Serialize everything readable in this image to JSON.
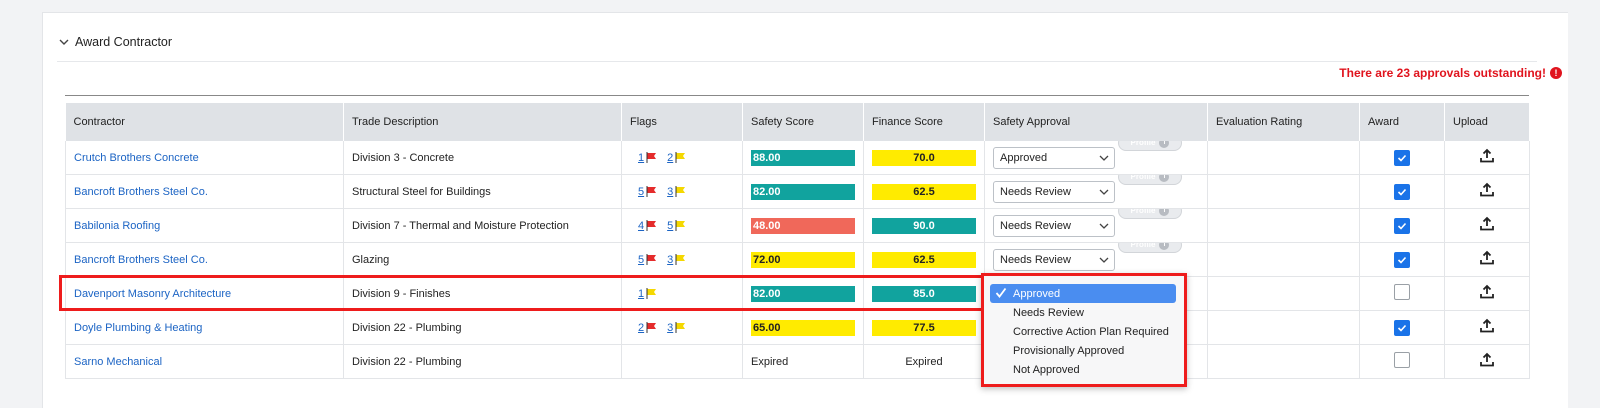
{
  "section": {
    "title": "Award Contractor"
  },
  "alert": {
    "text": "There are 23 approvals outstanding!",
    "icon": "!"
  },
  "columns": [
    "Contractor",
    "Trade Description",
    "Flags",
    "Safety Score",
    "Finance Score",
    "Safety Approval",
    "Evaluation Rating",
    "Award",
    "Upload"
  ],
  "profile_label": "Profile",
  "profile_info": "i",
  "colors": {
    "red_flag": "#e52b2b",
    "yellow_flag": "#f5d800",
    "teal": "#11a39e",
    "yellow": "#ffeb00",
    "red": "#f0685a",
    "link": "#1c64c4",
    "highlight": "#ee1c1c"
  },
  "rows": [
    {
      "contractor": "Crutch Brothers Concrete",
      "trade": "Division 3 - Concrete",
      "red_flags": "1",
      "yellow_flags": "2",
      "safety": "88.00",
      "safety_color": "#11a39e",
      "finance": "70.0",
      "finance_color": "#ffeb00",
      "approval": "Approved",
      "award": true
    },
    {
      "contractor": "Bancroft Brothers Steel Co.",
      "trade": "Structural Steel for Buildings",
      "red_flags": "5",
      "yellow_flags": "3",
      "safety": "82.00",
      "safety_color": "#11a39e",
      "finance": "62.5",
      "finance_color": "#ffeb00",
      "approval": "Needs Review",
      "award": true
    },
    {
      "contractor": "Babilonia Roofing",
      "trade": "Division 7 - Thermal and Moisture Protection",
      "red_flags": "4",
      "yellow_flags": "5",
      "safety": "48.00",
      "safety_color": "#f0685a",
      "finance": "90.0",
      "finance_color": "#11a39e",
      "approval": "Needs Review",
      "award": true
    },
    {
      "contractor": "Bancroft Brothers Steel Co.",
      "trade": "Glazing",
      "red_flags": "5",
      "yellow_flags": "3",
      "safety": "72.00",
      "safety_color": "#ffeb00",
      "finance": "62.5",
      "finance_color": "#ffeb00",
      "approval": "Needs Review",
      "award": true
    },
    {
      "contractor": "Davenport Masonry Architecture",
      "trade": "Division 9 - Finishes",
      "red_flags": "",
      "yellow_flags": "1",
      "safety": "82.00",
      "safety_color": "#11a39e",
      "finance": "85.0",
      "finance_color": "#11a39e",
      "approval": "",
      "award": false
    },
    {
      "contractor": "Doyle Plumbing & Heating",
      "trade": "Division 22 - Plumbing",
      "red_flags": "2",
      "yellow_flags": "3",
      "safety": "65.00",
      "safety_color": "#ffeb00",
      "finance": "77.5",
      "finance_color": "#ffeb00",
      "approval": "",
      "award": true
    },
    {
      "contractor": "Sarno Mechanical",
      "trade": "Division 22 - Plumbing",
      "red_flags": "",
      "yellow_flags": "",
      "safety": "Expired",
      "safety_color": "",
      "finance": "Expired",
      "finance_color": "",
      "approval": "",
      "award": false
    }
  ],
  "dropdown": {
    "options": [
      "Approved",
      "Needs Review",
      "Corrective Action Plan Required",
      "Provisionally Approved",
      "Not Approved"
    ],
    "selected": "Approved"
  }
}
